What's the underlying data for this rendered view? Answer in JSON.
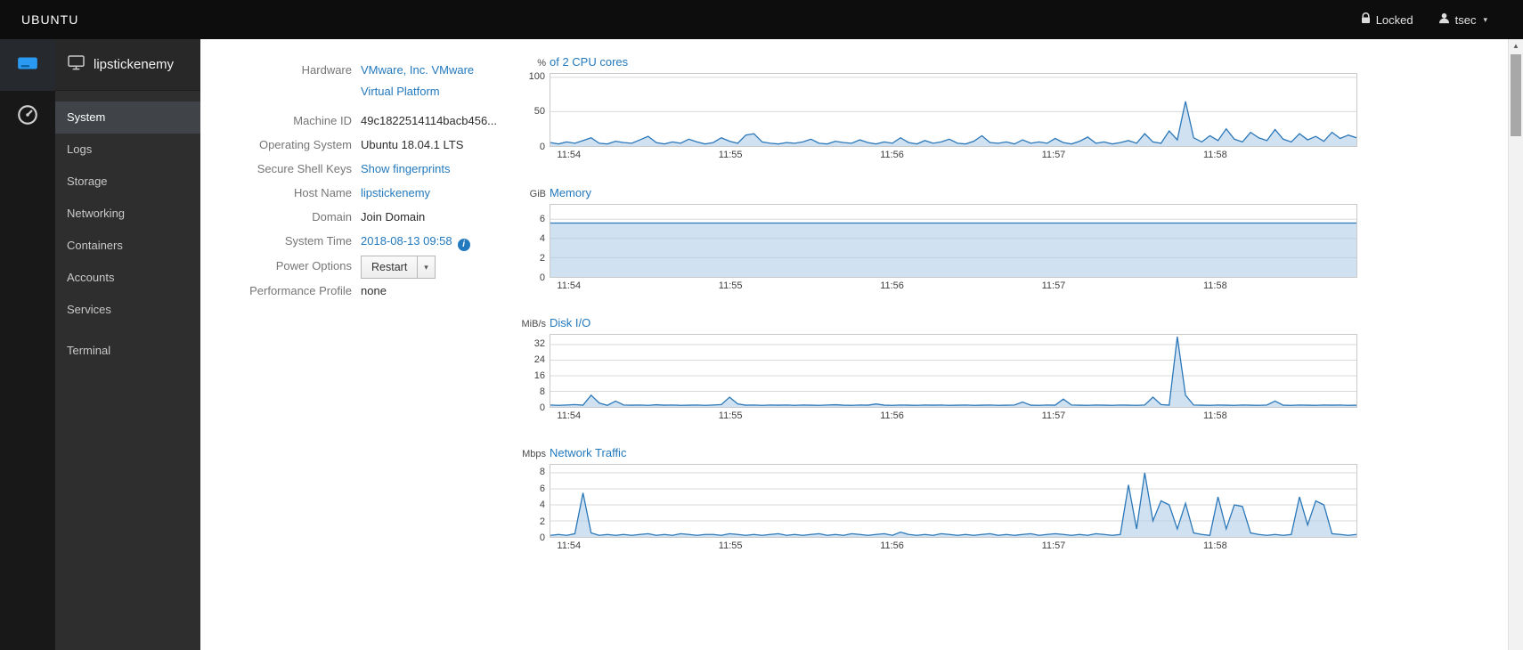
{
  "topbar": {
    "brand": "UBUNTU",
    "locked": "Locked",
    "user": "tsec"
  },
  "nav": {
    "host": "lipstickenemy",
    "items": [
      {
        "label": "System"
      },
      {
        "label": "Logs"
      },
      {
        "label": "Storage"
      },
      {
        "label": "Networking"
      },
      {
        "label": "Containers"
      },
      {
        "label": "Accounts"
      },
      {
        "label": "Services"
      },
      {
        "label": "Terminal"
      }
    ]
  },
  "info": {
    "rows": [
      {
        "label": "Hardware",
        "value": "VMware, Inc. VMware Virtual Platform"
      },
      {
        "label": "Machine ID",
        "value": "49c1822514114bacb456..."
      },
      {
        "label": "Operating System",
        "value": "Ubuntu 18.04.1 LTS"
      },
      {
        "label": "Secure Shell Keys",
        "value": "Show fingerprints"
      },
      {
        "label": "Host Name",
        "value": "lipstickenemy"
      },
      {
        "label": "Domain",
        "value": "Join Domain"
      },
      {
        "label": "System Time",
        "value": "2018-08-13 09:58"
      },
      {
        "label": "Power Options",
        "value": "Restart"
      },
      {
        "label": "Performance Profile",
        "value": "none"
      }
    ]
  },
  "colors": {
    "link": "#2379bd",
    "chart_line": "#2b77b8",
    "chart_fill": "#a9cbe8",
    "grid": "#d9d9d9",
    "accent": "#2b9af3"
  },
  "charts": [
    {
      "type": "area",
      "unit": "%",
      "title": "of 2 CPU cores",
      "ymax": 105,
      "yticks": [
        0,
        50,
        100
      ],
      "xticks": [
        "11:54",
        "11:55",
        "11:56",
        "11:57",
        "11:58"
      ],
      "xtick_pos": [
        0.024,
        0.224,
        0.424,
        0.624,
        0.824
      ],
      "values": [
        5,
        3,
        6,
        4,
        8,
        12,
        4,
        3,
        7,
        5,
        4,
        9,
        14,
        5,
        3,
        6,
        4,
        10,
        6,
        3,
        5,
        12,
        7,
        4,
        16,
        18,
        6,
        4,
        3,
        5,
        4,
        6,
        10,
        4,
        3,
        7,
        5,
        4,
        9,
        5,
        3,
        6,
        4,
        12,
        5,
        3,
        8,
        4,
        6,
        10,
        4,
        3,
        7,
        15,
        5,
        4,
        6,
        3,
        9,
        4,
        6,
        4,
        11,
        5,
        3,
        7,
        13,
        4,
        6,
        3,
        5,
        8,
        4,
        18,
        6,
        4,
        22,
        9,
        65,
        12,
        6,
        15,
        8,
        25,
        10,
        6,
        20,
        12,
        8,
        24,
        10,
        6,
        18,
        9,
        14,
        7,
        20,
        11,
        16,
        12
      ]
    },
    {
      "type": "area",
      "unit": "GiB",
      "title": "Memory",
      "ymax": 7.5,
      "yticks": [
        0,
        2,
        4,
        6
      ],
      "xticks": [
        "11:54",
        "11:55",
        "11:56",
        "11:57",
        "11:58"
      ],
      "xtick_pos": [
        0.024,
        0.224,
        0.424,
        0.624,
        0.824
      ],
      "values": [
        5.6,
        5.6,
        5.6,
        5.6,
        5.6,
        5.6,
        5.6,
        5.6,
        5.6,
        5.6,
        5.6,
        5.6,
        5.6,
        5.6,
        5.6,
        5.6,
        5.6,
        5.6,
        5.6,
        5.6
      ]
    },
    {
      "type": "area",
      "unit": "MiB/s",
      "title": "Disk I/O",
      "ymax": 37,
      "yticks": [
        0,
        8,
        16,
        24,
        32
      ],
      "xticks": [
        "11:54",
        "11:55",
        "11:56",
        "11:57",
        "11:58"
      ],
      "xtick_pos": [
        0.024,
        0.224,
        0.424,
        0.624,
        0.824
      ],
      "values": [
        1,
        0.8,
        1,
        1.2,
        0.9,
        6,
        2,
        0.8,
        3,
        1,
        0.9,
        1,
        0.8,
        1.1,
        0.9,
        1,
        0.8,
        0.9,
        1,
        0.8,
        1,
        1.2,
        5,
        1.5,
        0.9,
        1,
        0.8,
        1,
        0.9,
        1,
        0.8,
        1,
        0.9,
        0.8,
        1,
        1.1,
        0.9,
        0.8,
        1,
        0.9,
        1.5,
        0.9,
        0.8,
        1,
        0.9,
        0.8,
        1,
        0.9,
        1,
        0.8,
        0.9,
        1,
        0.8,
        0.9,
        1,
        0.8,
        0.9,
        1,
        2.5,
        0.9,
        0.8,
        1,
        0.9,
        4,
        1,
        0.9,
        0.8,
        1,
        0.9,
        0.8,
        1,
        0.9,
        0.8,
        1,
        5,
        1.2,
        0.9,
        36,
        6,
        1,
        0.9,
        0.8,
        1,
        0.9,
        0.8,
        1,
        0.9,
        0.8,
        1,
        3,
        0.9,
        0.8,
        1,
        0.9,
        0.8,
        1,
        0.9,
        1,
        0.8,
        0.9
      ]
    },
    {
      "type": "area",
      "unit": "Mbps",
      "title": "Network Traffic",
      "ymax": 9,
      "yticks": [
        0,
        2,
        4,
        6,
        8
      ],
      "xticks": [
        "11:54",
        "11:55",
        "11:56",
        "11:57",
        "11:58"
      ],
      "xtick_pos": [
        0.024,
        0.224,
        0.424,
        0.624,
        0.824
      ],
      "values": [
        0.2,
        0.3,
        0.2,
        0.4,
        5.5,
        0.5,
        0.2,
        0.3,
        0.2,
        0.3,
        0.2,
        0.3,
        0.4,
        0.2,
        0.3,
        0.2,
        0.4,
        0.3,
        0.2,
        0.3,
        0.3,
        0.2,
        0.4,
        0.3,
        0.2,
        0.3,
        0.2,
        0.3,
        0.4,
        0.2,
        0.3,
        0.2,
        0.3,
        0.4,
        0.2,
        0.3,
        0.2,
        0.4,
        0.3,
        0.2,
        0.3,
        0.4,
        0.2,
        0.6,
        0.3,
        0.2,
        0.3,
        0.2,
        0.4,
        0.3,
        0.2,
        0.3,
        0.2,
        0.3,
        0.4,
        0.2,
        0.3,
        0.2,
        0.3,
        0.4,
        0.2,
        0.3,
        0.4,
        0.3,
        0.2,
        0.3,
        0.2,
        0.4,
        0.3,
        0.2,
        0.3,
        6.5,
        1,
        8,
        2,
        4.5,
        4,
        1,
        4.2,
        0.5,
        0.3,
        0.2,
        5,
        1,
        4,
        3.8,
        0.5,
        0.3,
        0.2,
        0.3,
        0.2,
        0.3,
        5,
        1.5,
        4.5,
        4,
        0.4,
        0.3,
        0.2,
        0.3
      ]
    }
  ]
}
